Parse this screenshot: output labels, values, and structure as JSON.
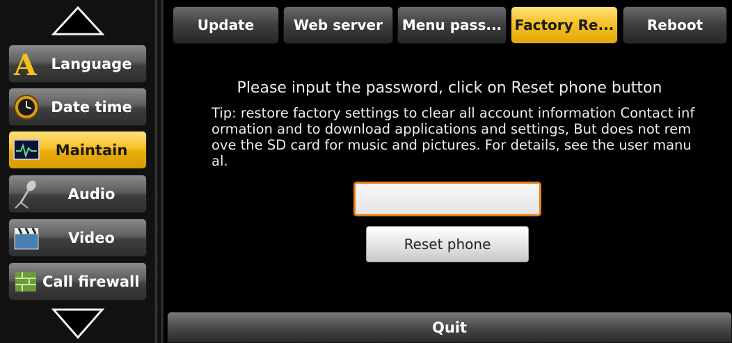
{
  "sidebar": {
    "items": [
      {
        "label": "Language",
        "icon": "language-icon",
        "active": false
      },
      {
        "label": "Date time",
        "icon": "clock-icon",
        "active": false
      },
      {
        "label": "Maintain",
        "icon": "monitor-icon",
        "active": true
      },
      {
        "label": "Audio",
        "icon": "microphone-icon",
        "active": false
      },
      {
        "label": "Video",
        "icon": "clapperboard-icon",
        "active": false
      },
      {
        "label": "Call firewall",
        "icon": "firewall-icon",
        "active": false
      }
    ]
  },
  "tabs": [
    {
      "label": "Update",
      "active": false
    },
    {
      "label": "Web server",
      "active": false
    },
    {
      "label": "Menu pass...",
      "active": false
    },
    {
      "label": "Factory Re...",
      "active": true
    },
    {
      "label": "Reboot",
      "active": false
    }
  ],
  "content": {
    "instruction": "Please input the password, click on Reset phone button",
    "tip": "Tip: restore factory settings to clear all account information Contact information and to download applications and settings, But does not remove the SD card for music and pictures. For details, see the user manual.",
    "password_value": "",
    "reset_button": "Reset phone"
  },
  "footer": {
    "quit_label": "Quit"
  },
  "colors": {
    "accent": "#f5c227",
    "input_border": "#e87b18"
  }
}
